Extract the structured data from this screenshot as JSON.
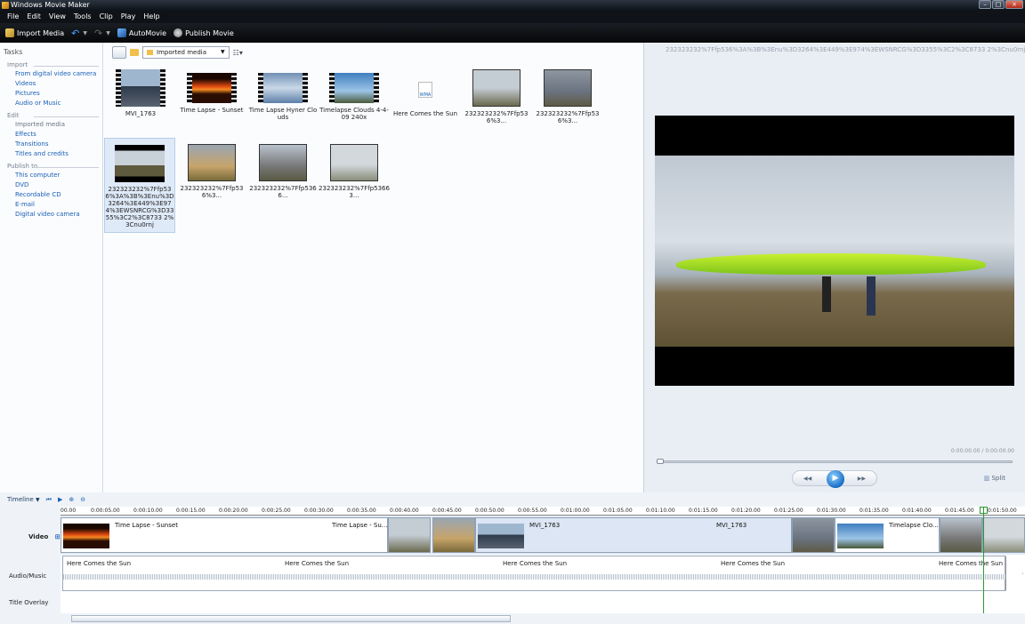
{
  "window": {
    "title": "Windows Movie Maker"
  },
  "menu": [
    "File",
    "Edit",
    "View",
    "Tools",
    "Clip",
    "Play",
    "Help"
  ],
  "toolbar": {
    "import_media": "Import Media",
    "automovie": "AutoMovie",
    "publish_movie": "Publish Movie"
  },
  "tasks": {
    "header": "Tasks",
    "import": {
      "label": "Import",
      "items": [
        "From digital video camera",
        "Videos",
        "Pictures",
        "Audio or Music"
      ]
    },
    "edit": {
      "label": "Edit",
      "items": [
        "Imported media",
        "Effects",
        "Transitions",
        "Titles and credits"
      ]
    },
    "publish": {
      "label": "Publish to",
      "items": [
        "This computer",
        "DVD",
        "Recordable CD",
        "E-mail",
        "Digital video camera"
      ]
    }
  },
  "collection": {
    "dropdown": "Imported media",
    "tiles": [
      {
        "label": "MVI_1763"
      },
      {
        "label": "Time Lapse - Sunset"
      },
      {
        "label": "Time Lapse Hyner Clouds"
      },
      {
        "label": "Timelapse Clouds 4-4-09 240x"
      },
      {
        "label": "Here Comes the Sun",
        "badge": "WMA"
      },
      {
        "label": "232323232%7Ffp536%3..."
      },
      {
        "label": "232323232%7Ffp536%3..."
      },
      {
        "label": "232323232%7Ffp536%3A%3B%3Enu%3D3264%3E449%3E974%3EWSNRCG%3D3355%3C2%3C8733 2%3Cnu0rnj"
      },
      {
        "label": "232323232%7Ffp536%3..."
      },
      {
        "label": "232323232%7Ffp5366..."
      },
      {
        "label": "232323232%7Ffp53663..."
      }
    ]
  },
  "preview": {
    "title": "232323232%7Ffp536%3A%3B%3Enu%3D3264%3E449%3E974%3EWSNRCG%3D3355%3C2%3C8733 2%3Cnu0rnj",
    "time": "0:00:00.00 / 0:00:00.00",
    "split": "Split"
  },
  "timeline": {
    "mode": "Timeline",
    "tracks": {
      "video": "Video",
      "audio": "Audio/Music",
      "title_overlay": "Title Overlay"
    },
    "ruler": [
      "00.00",
      "0:00:05.00",
      "0:00:10.00",
      "0:00:15.00",
      "0:00:20.00",
      "0:00:25.00",
      "0:00:30.00",
      "0:00:35.00",
      "0:00:40.00",
      "0:00:45.00",
      "0:00:50.00",
      "0:00:55.00",
      "0:01:00.00",
      "0:01:05.00",
      "0:01:10.00",
      "0:01:15.00",
      "0:01:20.00",
      "0:01:25.00",
      "0:01:30.00",
      "0:01:35.00",
      "0:01:40.00",
      "0:01:45.00",
      "0:01:50.00"
    ],
    "video_clips": {
      "clip1_left": "Time Lapse - Sunset",
      "clip1_right": "Time Lapse - Su...",
      "clip2_left": "MVI_1763",
      "clip2_right": "MVI_1763",
      "clip3": "Timelapse Clo..."
    },
    "audio_label": "Here Comes the Sun"
  }
}
